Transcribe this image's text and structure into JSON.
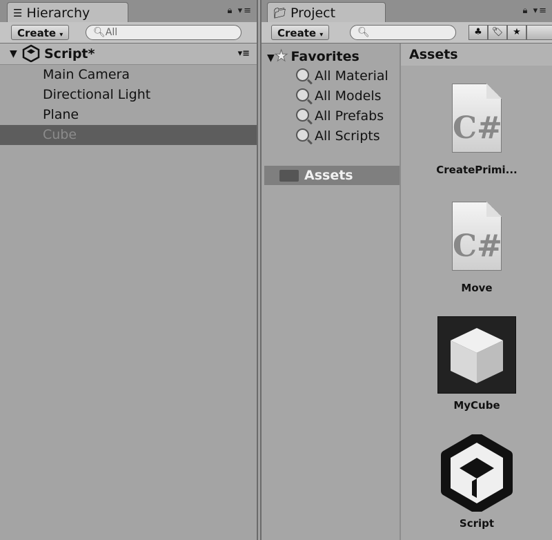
{
  "hierarchy": {
    "tab_label": "Hierarchy",
    "create_label": "Create",
    "search_placeholder": "All",
    "scene_name": "Script*",
    "items": [
      {
        "label": "Main Camera",
        "selected": false
      },
      {
        "label": "Directional Light",
        "selected": false
      },
      {
        "label": "Plane",
        "selected": false
      },
      {
        "label": "Cube",
        "selected": true
      }
    ]
  },
  "project": {
    "tab_label": "Project",
    "create_label": "Create",
    "favorites": {
      "label": "Favorites",
      "items": [
        "All Material",
        "All Models",
        "All Prefabs",
        "All Scripts"
      ]
    },
    "folder_label": "Assets",
    "assets_header": "Assets",
    "assets": [
      {
        "name": "CreatePrimi...",
        "type": "csharp"
      },
      {
        "name": "Move",
        "type": "csharp"
      },
      {
        "name": "MyCube",
        "type": "prefab"
      },
      {
        "name": "Script",
        "type": "unity-scene"
      }
    ]
  },
  "icons": {
    "hierarchy_tab": "list-icon",
    "project_tab": "folder-icon",
    "lock": "lock-icon",
    "menu": "menu-icon"
  },
  "colors": {
    "panel_bg": "#a4a4a4",
    "selection_bg": "#5d5d5d",
    "selection_text": "#8c8c8c"
  }
}
